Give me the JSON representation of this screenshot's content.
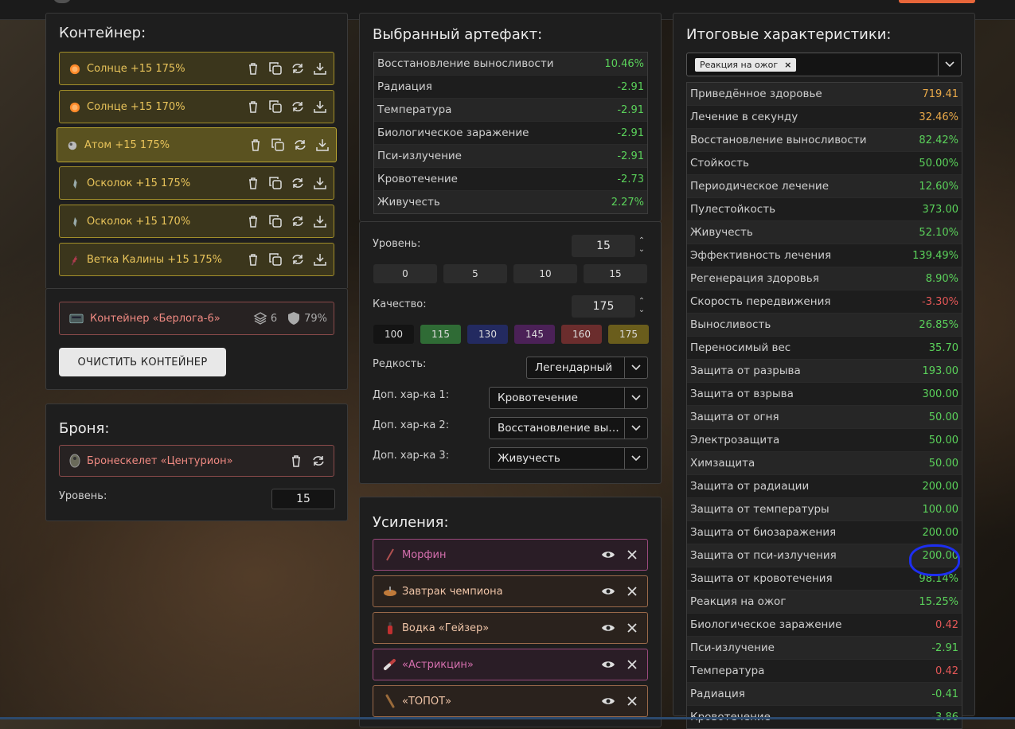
{
  "container": {
    "title": "Контейнер:",
    "slots": [
      {
        "label": "Солнце +15 175%",
        "icon": "sun-artifact-icon"
      },
      {
        "label": "Солнце +15 170%",
        "icon": "sun-artifact-icon"
      },
      {
        "label": "Атом +15 175%",
        "icon": "atom-artifact-icon"
      },
      {
        "label": "Осколок +15 175%",
        "icon": "shard-artifact-icon"
      },
      {
        "label": "Осколок +15 170%",
        "icon": "shard-artifact-icon"
      },
      {
        "label": "Ветка Калины +15 175%",
        "icon": "viburnum-branch-icon"
      }
    ],
    "container_name": "Контейнер «Берлога-6»",
    "slots_count": "6",
    "protection": "79%",
    "clear_button": "ОЧИСТИТЬ КОНТЕЙНЕР"
  },
  "armor": {
    "title": "Броня:",
    "name": "Бронескелет «Центурион»",
    "level_label": "Уровень:",
    "level_value": "15"
  },
  "artifact": {
    "title": "Выбранный артефакт:",
    "stats": [
      {
        "name": "Восстановление выносливости",
        "value": "10.46%",
        "tone": "green"
      },
      {
        "name": "Радиация",
        "value": "-2.91",
        "tone": "green"
      },
      {
        "name": "Температура",
        "value": "-2.91",
        "tone": "green"
      },
      {
        "name": "Биологическое заражение",
        "value": "-2.91",
        "tone": "green"
      },
      {
        "name": "Пси-излучение",
        "value": "-2.91",
        "tone": "green"
      },
      {
        "name": "Кровотечение",
        "value": "-2.73",
        "tone": "green"
      },
      {
        "name": "Живучесть",
        "value": "2.27%",
        "tone": "green"
      }
    ],
    "level_label": "Уровень:",
    "level_value": "15",
    "level_buttons": [
      "0",
      "5",
      "10",
      "15"
    ],
    "quality_label": "Качество:",
    "quality_value": "175",
    "quality_buttons": [
      {
        "label": "100",
        "color": "#141414"
      },
      {
        "label": "115",
        "color": "#2f6b35"
      },
      {
        "label": "130",
        "color": "#232a60"
      },
      {
        "label": "145",
        "color": "#4b2157"
      },
      {
        "label": "160",
        "color": "#6b2d2d"
      },
      {
        "label": "175",
        "color": "#6a5d1c"
      }
    ],
    "rarity_label": "Редкость:",
    "rarity_value": "Легендарный",
    "extra1_label": "Доп. хар-ка 1:",
    "extra1_value": "Кровотечение",
    "extra2_label": "Доп. хар-ка 2:",
    "extra2_value": "Восстановление выносливости",
    "extra3_label": "Доп. хар-ка 3:",
    "extra3_value": "Живучесть"
  },
  "boosts": {
    "title": "Усиления:",
    "items": [
      {
        "label": "Морфин",
        "color": "#d56fae",
        "border": "#9b4a7d",
        "bg": "#2a1d26",
        "icon": "syringe-icon"
      },
      {
        "label": "Завтрак чемпиона",
        "color": "#f0c5a8",
        "border": "#9b6a4a",
        "bg": "#2a221d",
        "icon": "food-icon"
      },
      {
        "label": "Водка «Гейзер»",
        "color": "#f0c5a8",
        "border": "#9b6a4a",
        "bg": "#2a221d",
        "icon": "bottle-icon"
      },
      {
        "label": "«Астрикцин»",
        "color": "#d56fae",
        "border": "#9b4a7d",
        "bg": "#2a1d26",
        "icon": "pill-icon"
      },
      {
        "label": "«ТОПОТ»",
        "color": "#f0c5a8",
        "border": "#9b6a4a",
        "bg": "#2a221d",
        "icon": "stick-icon"
      }
    ]
  },
  "totals": {
    "title": "Итоговые характеристики:",
    "filter_tag": "Реакция на ожог",
    "stats": [
      {
        "name": "Приведённое здоровье",
        "value": "719.41",
        "tone": "orange"
      },
      {
        "name": "Лечение в секунду",
        "value": "32.46%",
        "tone": "orange"
      },
      {
        "name": "Восстановление выносливости",
        "value": "82.42%",
        "tone": "green"
      },
      {
        "name": "Стойкость",
        "value": "50.00%",
        "tone": "green"
      },
      {
        "name": "Периодическое лечение",
        "value": "12.60%",
        "tone": "green"
      },
      {
        "name": "Пулестойкость",
        "value": "373.00",
        "tone": "green"
      },
      {
        "name": "Живучесть",
        "value": "52.10%",
        "tone": "green"
      },
      {
        "name": "Эффективность лечения",
        "value": "139.49%",
        "tone": "green"
      },
      {
        "name": "Регенерация здоровья",
        "value": "8.90%",
        "tone": "green"
      },
      {
        "name": "Скорость передвижения",
        "value": "-3.30%",
        "tone": "red"
      },
      {
        "name": "Выносливость",
        "value": "26.85%",
        "tone": "green"
      },
      {
        "name": "Переносимый вес",
        "value": "35.70",
        "tone": "green"
      },
      {
        "name": "Защита от разрыва",
        "value": "193.00",
        "tone": "green"
      },
      {
        "name": "Защита от взрыва",
        "value": "300.00",
        "tone": "green"
      },
      {
        "name": "Защита от огня",
        "value": "50.00",
        "tone": "green"
      },
      {
        "name": "Электрозащита",
        "value": "50.00",
        "tone": "green"
      },
      {
        "name": "Химзащита",
        "value": "50.00",
        "tone": "green"
      },
      {
        "name": "Защита от радиации",
        "value": "200.00",
        "tone": "green"
      },
      {
        "name": "Защита от температуры",
        "value": "100.00",
        "tone": "green"
      },
      {
        "name": "Защита от биозаражения",
        "value": "200.00",
        "tone": "green"
      },
      {
        "name": "Защита от пси-излучения",
        "value": "200.00",
        "tone": "green"
      },
      {
        "name": "Защита от кровотечения",
        "value": "98.14%",
        "tone": "green"
      },
      {
        "name": "Реакция на ожог",
        "value": "15.25%",
        "tone": "green"
      },
      {
        "name": "Биологическое заражение",
        "value": "0.42",
        "tone": "red"
      },
      {
        "name": "Пси-излучение",
        "value": "-2.91",
        "tone": "green"
      },
      {
        "name": "Температура",
        "value": "0.42",
        "tone": "red"
      },
      {
        "name": "Радиация",
        "value": "-0.41",
        "tone": "green"
      },
      {
        "name": "Кровотечение",
        "value": "-3.86",
        "tone": "green"
      }
    ]
  }
}
